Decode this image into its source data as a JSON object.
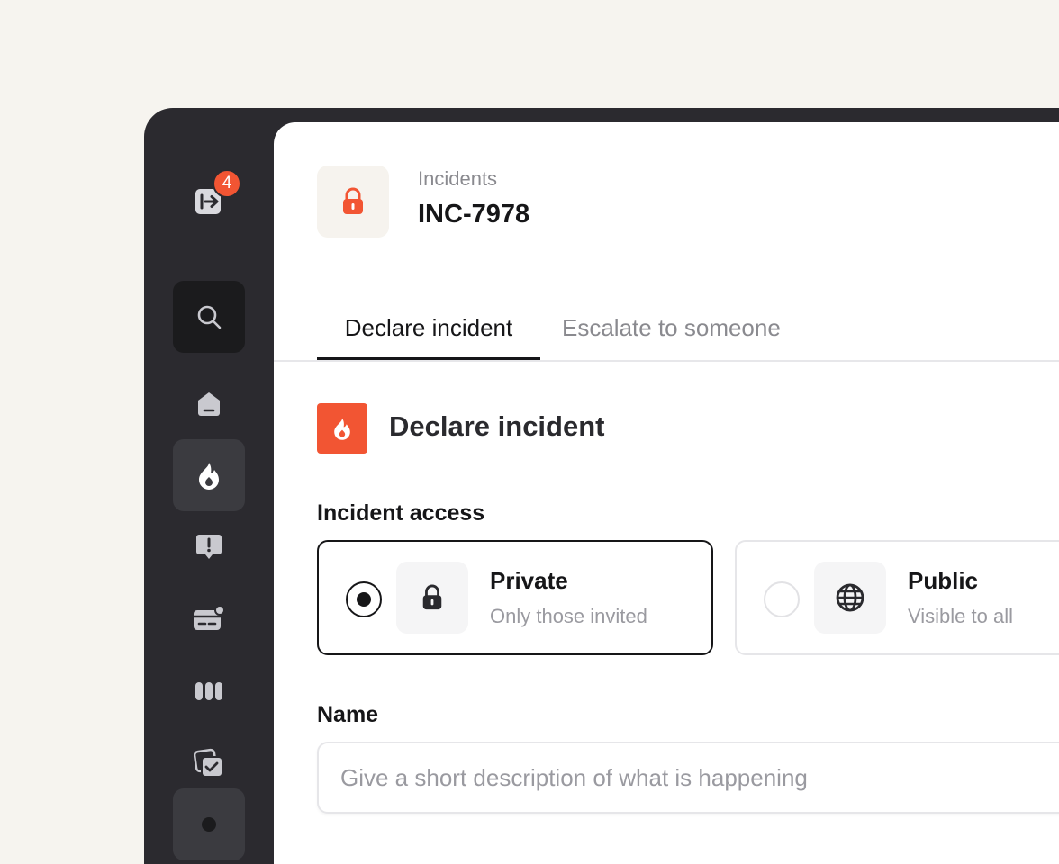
{
  "sidebar": {
    "notification_count": "4",
    "items": [
      {
        "icon": "sign-out-icon"
      },
      {
        "icon": "search-icon"
      },
      {
        "icon": "home-icon"
      },
      {
        "icon": "flame-icon",
        "active": true
      },
      {
        "icon": "alert-message-icon"
      },
      {
        "icon": "status-page-icon"
      },
      {
        "icon": "columns-icon"
      },
      {
        "icon": "checklist-icon"
      },
      {
        "icon": "dot-icon"
      }
    ]
  },
  "header": {
    "icon": "lock-icon",
    "breadcrumb": "Incidents",
    "title": "INC-7978"
  },
  "tabs": [
    {
      "label": "Declare incident",
      "active": true
    },
    {
      "label": "Escalate to someone",
      "active": false
    }
  ],
  "section": {
    "icon": "flame-icon",
    "title": "Declare incident"
  },
  "access": {
    "label": "Incident access",
    "options": [
      {
        "title": "Private",
        "subtitle": "Only those invited",
        "icon": "lock-icon",
        "selected": true
      },
      {
        "title": "Public",
        "subtitle": "Visible to all",
        "icon": "globe-icon",
        "selected": false
      }
    ]
  },
  "name_field": {
    "label": "Name",
    "placeholder": "Give a short description of what is happening",
    "value": ""
  },
  "colors": {
    "accent": "#f25533",
    "sidebar": "#2b2a2f",
    "page_background": "#f6f4ef"
  }
}
